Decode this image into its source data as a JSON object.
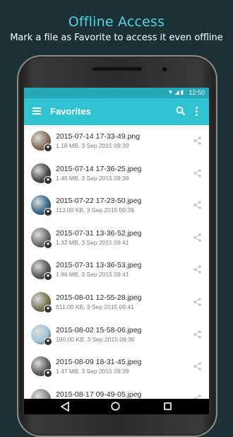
{
  "promo": {
    "title": "Offline Access",
    "subtitle": "Mark a file as Favorite to access it even offline"
  },
  "status_bar": {
    "time": "12:50"
  },
  "app_bar": {
    "title": "Favorites",
    "icons": [
      "menu-icon",
      "search-icon",
      "more-icon"
    ]
  },
  "files": [
    {
      "name": "2015-07-14 17-33-49.png",
      "meta": "1.18 MB, 3 Sep 2015 09:39",
      "thumb": "#8b6f5c"
    },
    {
      "name": "2015-07-14 17-36-25.jpeg",
      "meta": "1.46 MB, 3 Sep 2015 09:39",
      "thumb": "#4a4a48"
    },
    {
      "name": "2015-07-22 17-23-50.jpeg",
      "meta": "112.00 KB, 3 Sep 2015 09:39",
      "thumb": "#3b6a8a"
    },
    {
      "name": "2015-07-31 13-36-52.jpeg",
      "meta": "1.32 MB, 3 Sep 2015 09:41",
      "thumb": "#6e6e6e"
    },
    {
      "name": "2015-07-31 13-36-53.jpeg",
      "meta": "1.86 MB, 3 Sep 2015 09:41",
      "thumb": "#5a5a5a"
    },
    {
      "name": "2015-08-01 12-55-28.jpeg",
      "meta": "611.00 KB, 3 Sep 2015 09:41",
      "thumb": "#7d7552"
    },
    {
      "name": "2015-08-02 15-58-06.jpeg",
      "meta": "190.00 KB, 3 Sep 2015 09:36",
      "thumb": "#9fc6d9"
    },
    {
      "name": "2015-08-09 18-31-45.jpeg",
      "meta": "1.47 MB, 3 Sep 2015 09:39",
      "thumb": "#5c6160"
    },
    {
      "name": "2015-08-17 09-49-05.jpeg",
      "meta": "",
      "thumb": "#8a8a8a"
    }
  ],
  "colors": {
    "background": "#1c3135",
    "accent": "#31c3d1",
    "status_bar": "#25a9b8",
    "promo_title": "#4fd6e3"
  }
}
